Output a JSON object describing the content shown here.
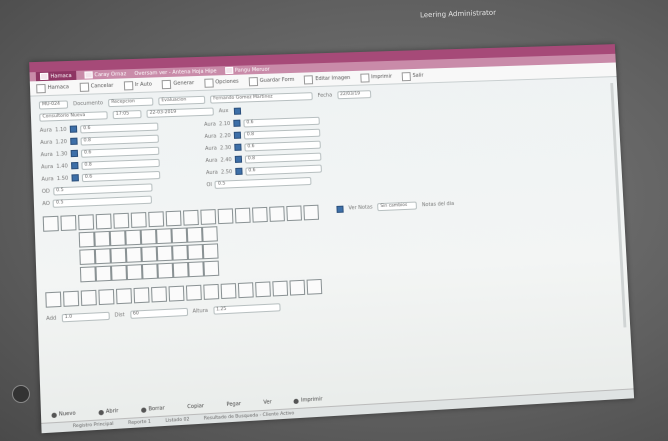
{
  "window": {
    "user_label": "Leering Administrator"
  },
  "tabs": [
    {
      "label": "Hamaca"
    },
    {
      "label": "Caray Ornaz"
    },
    {
      "label": "Oversam ver - Antena Hoja Hipe"
    },
    {
      "label": "Pangu Meruor"
    }
  ],
  "toolbar": [
    {
      "label": "Hamaca"
    },
    {
      "label": "Cancelar"
    },
    {
      "label": "Ir Auto"
    },
    {
      "label": "Generar"
    },
    {
      "label": "Opciones"
    },
    {
      "label": "Guardar Form"
    },
    {
      "label": "Editar Imagen"
    },
    {
      "label": "Imprimir"
    },
    {
      "label": "Salir"
    }
  ],
  "header": {
    "code": "MU-024",
    "doc_label": "Documento",
    "doc_value": "Recepcion",
    "name_value": "Fernando Gomez Martinez",
    "date_label": "Fecha",
    "date_value": "22/03/19",
    "sub_value": "Consultorio Nueva",
    "time_value": "17:05",
    "type_value": "Evaluacion",
    "ref_value": "22-03-2019",
    "aux_label": "Aux"
  },
  "left_fields": [
    {
      "label": "Aura",
      "code": "1.10",
      "value": "0.6"
    },
    {
      "label": "Aura",
      "code": "1.20",
      "value": "0.8"
    },
    {
      "label": "Aura",
      "code": "1.30",
      "value": "0.6"
    },
    {
      "label": "Aura",
      "code": "1.40",
      "value": "0.8"
    },
    {
      "label": "Aura",
      "code": "1.50",
      "value": "0.6"
    }
  ],
  "right_fields": [
    {
      "label": "Aura",
      "code": "2.10",
      "value": "0.6"
    },
    {
      "label": "Aura",
      "code": "2.20",
      "value": "0.8"
    },
    {
      "label": "Aura",
      "code": "2.30",
      "value": "0.6"
    },
    {
      "label": "Aura",
      "code": "2.40",
      "value": "0.8"
    },
    {
      "label": "Aura",
      "code": "2.50",
      "value": "0.6"
    }
  ],
  "extra_fields": [
    {
      "label": "OD",
      "value": "0.5"
    },
    {
      "label": "OI",
      "value": "0.5"
    },
    {
      "label": "AO",
      "value": "0.5"
    }
  ],
  "side_note": {
    "label": "Ver Notas",
    "value": "Sin cambios",
    "hint": "Notas del dia"
  },
  "bottom_fields": [
    {
      "label": "Add",
      "value": "1.0"
    },
    {
      "label": "Dist",
      "value": "60"
    },
    {
      "label": "Altura",
      "value": "1.25"
    }
  ],
  "bottom_buttons": [
    {
      "label": "Nuevo"
    },
    {
      "label": "Abrir"
    },
    {
      "label": "Borrar"
    },
    {
      "label": "Copiar"
    },
    {
      "label": "Pegar"
    },
    {
      "label": "Ver"
    },
    {
      "label": "Imprimir"
    }
  ],
  "statusbar": [
    {
      "label": "Registro Principal"
    },
    {
      "label": "Reporte 1"
    },
    {
      "label": "Listado 02"
    },
    {
      "label": "Resultado de Busqueda - Cliente Activo"
    }
  ],
  "colors": {
    "accent": "#a64a78",
    "tab_bar": "#c98ba9",
    "checkbox": "#3d6fa8"
  }
}
